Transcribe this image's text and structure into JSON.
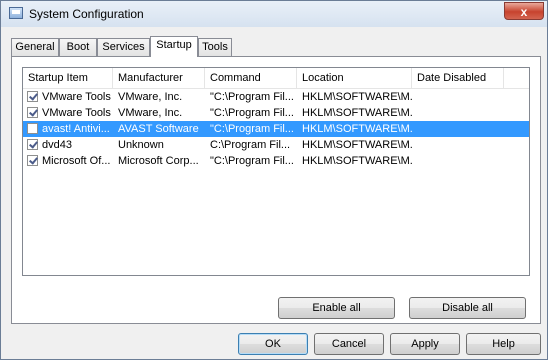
{
  "window": {
    "title": "System Configuration",
    "close_glyph": "x"
  },
  "tabs": [
    {
      "label": "General"
    },
    {
      "label": "Boot"
    },
    {
      "label": "Services"
    },
    {
      "label": "Startup"
    },
    {
      "label": "Tools"
    }
  ],
  "active_tab": "Startup",
  "table": {
    "columns": [
      "Startup Item",
      "Manufacturer",
      "Command",
      "Location",
      "Date Disabled"
    ],
    "rows": [
      {
        "checked": true,
        "item": "VMware Tools",
        "manufacturer": "VMware, Inc.",
        "command": "\"C:\\Program Fil...",
        "location": "HKLM\\SOFTWARE\\M...",
        "date_disabled": "",
        "selected": false
      },
      {
        "checked": true,
        "item": "VMware Tools",
        "manufacturer": "VMware, Inc.",
        "command": "\"C:\\Program Fil...",
        "location": "HKLM\\SOFTWARE\\M...",
        "date_disabled": "",
        "selected": false
      },
      {
        "checked": false,
        "item": "avast! Antivi...",
        "manufacturer": "AVAST Software",
        "command": "\"C:\\Program Fil...",
        "location": "HKLM\\SOFTWARE\\M...",
        "date_disabled": "",
        "selected": true
      },
      {
        "checked": true,
        "item": "dvd43",
        "manufacturer": "Unknown",
        "command": "C:\\Program Fil...",
        "location": "HKLM\\SOFTWARE\\M...",
        "date_disabled": "",
        "selected": false
      },
      {
        "checked": true,
        "item": "Microsoft Of...",
        "manufacturer": "Microsoft Corp...",
        "command": "\"C:\\Program Fil...",
        "location": "HKLM\\SOFTWARE\\M...",
        "date_disabled": "",
        "selected": false
      }
    ]
  },
  "panel_buttons": {
    "enable_all": "Enable all",
    "disable_all": "Disable all"
  },
  "dialog_buttons": {
    "ok": "OK",
    "cancel": "Cancel",
    "apply": "Apply",
    "help": "Help"
  },
  "colors": {
    "selection": "#3399ff",
    "close_button": "#c7432e"
  }
}
